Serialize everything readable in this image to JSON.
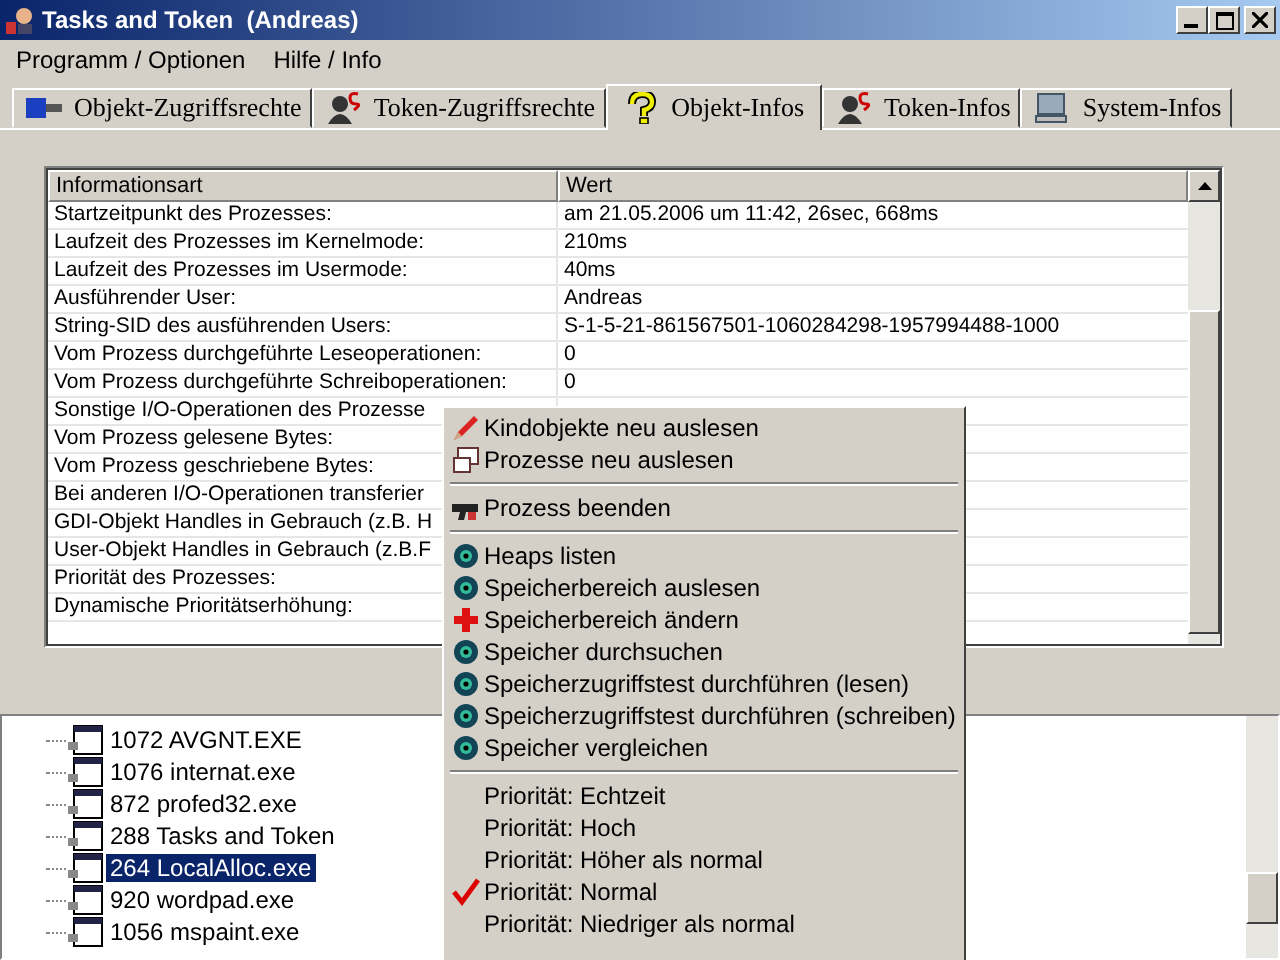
{
  "window": {
    "title": "Tasks and Token  (Andreas)"
  },
  "menubar": [
    "Programm / Optionen",
    "Hilfe / Info"
  ],
  "tabs": [
    {
      "label": "Objekt-Zugriffsrechte",
      "selected": false
    },
    {
      "label": "Token-Zugriffsrechte",
      "selected": false
    },
    {
      "label": "Objekt-Infos",
      "selected": true
    },
    {
      "label": "Token-Infos",
      "selected": false
    },
    {
      "label": "System-Infos",
      "selected": false
    }
  ],
  "table": {
    "columns": [
      "Informationsart",
      "Wert"
    ],
    "rows": [
      {
        "label": "Startzeitpunkt des Prozesses:",
        "value": "am 21.05.2006 um 11:42, 26sec, 668ms"
      },
      {
        "label": "Laufzeit des Prozesses im Kernelmode:",
        "value": "210ms"
      },
      {
        "label": "Laufzeit des Prozesses im Usermode:",
        "value": "40ms"
      },
      {
        "label": "Ausführender User:",
        "value": "Andreas"
      },
      {
        "label": "String-SID des ausführenden Users:",
        "value": "S-1-5-21-861567501-1060284298-1957994488-1000"
      },
      {
        "label": "Vom Prozess durchgeführte Leseoperationen:",
        "value": "0"
      },
      {
        "label": "Vom Prozess durchgeführte Schreiboperationen:",
        "value": "0"
      },
      {
        "label": "Sonstige I/O-Operationen des Prozesse"
      },
      {
        "label": "Vom Prozess gelesene Bytes:"
      },
      {
        "label": "Vom Prozess geschriebene Bytes:"
      },
      {
        "label": "Bei anderen I/O-Operationen transferier"
      },
      {
        "label": "GDI-Objekt Handles in Gebrauch (z.B. H"
      },
      {
        "label": "User-Objekt Handles in Gebrauch (z.B.F"
      },
      {
        "label": "Priorität des Prozesses:"
      },
      {
        "label": "Dynamische Prioritätserhöhung:"
      }
    ]
  },
  "process_tree": [
    {
      "label": "1072 AVGNT.EXE",
      "selected": false
    },
    {
      "label": "1076 internat.exe",
      "selected": false
    },
    {
      "label": "872 profed32.exe",
      "selected": false
    },
    {
      "label": "288 Tasks and Token",
      "selected": false
    },
    {
      "label": "264 LocalAlloc.exe",
      "selected": true
    },
    {
      "label": "920 wordpad.exe",
      "selected": false
    },
    {
      "label": "1056 mspaint.exe",
      "selected": false
    }
  ],
  "context_menu": [
    {
      "kind": "command",
      "label": "Kindobjekte neu auslesen"
    },
    {
      "kind": "command",
      "label": "Prozesse neu auslesen"
    },
    {
      "kind": "separator"
    },
    {
      "kind": "command",
      "label": "Prozess beenden"
    },
    {
      "kind": "separator"
    },
    {
      "kind": "command",
      "label": "Heaps listen"
    },
    {
      "kind": "command",
      "label": "Speicherbereich auslesen"
    },
    {
      "kind": "command",
      "label": "Speicherbereich ändern"
    },
    {
      "kind": "command",
      "label": "Speicher durchsuchen"
    },
    {
      "kind": "command",
      "label": "Speicherzugriffstest durchführen (lesen)"
    },
    {
      "kind": "command",
      "label": "Speicherzugriffstest durchführen (schreiben)"
    },
    {
      "kind": "command",
      "label": "Speicher vergleichen"
    },
    {
      "kind": "separator"
    },
    {
      "kind": "option",
      "label": "Priorität: Echtzeit",
      "checked": false
    },
    {
      "kind": "option",
      "label": "Priorität: Hoch",
      "checked": false
    },
    {
      "kind": "option",
      "label": "Priorität: Höher als normal",
      "checked": false
    },
    {
      "kind": "option",
      "label": "Priorität: Normal",
      "checked": true
    },
    {
      "kind": "option",
      "label": "Priorität: Niedriger als normal",
      "checked": false
    }
  ]
}
